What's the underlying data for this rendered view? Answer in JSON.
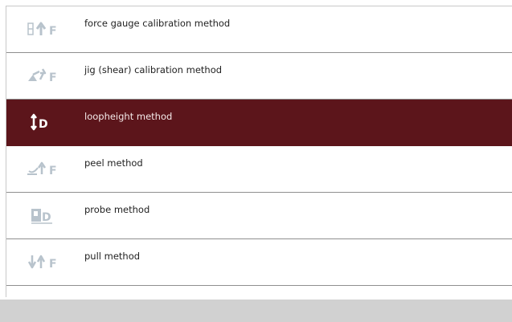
{
  "methods": [
    {
      "label": "force gauge calibration method",
      "icon": "force-gauge-icon",
      "selected": false
    },
    {
      "label": "jig (shear) calibration method",
      "icon": "shear-jig-icon",
      "selected": false
    },
    {
      "label": "loopheight method",
      "icon": "loopheight-icon",
      "selected": true
    },
    {
      "label": "peel method",
      "icon": "peel-icon",
      "selected": false
    },
    {
      "label": "probe method",
      "icon": "probe-icon",
      "selected": false
    },
    {
      "label": "pull method",
      "icon": "pull-icon",
      "selected": false
    }
  ],
  "icon_letters": {
    "force": "F",
    "distance": "D"
  },
  "colors": {
    "selected_background": "#5c151b",
    "icon_muted": "#b8c3cc",
    "icon_selected": "#ffffff"
  }
}
